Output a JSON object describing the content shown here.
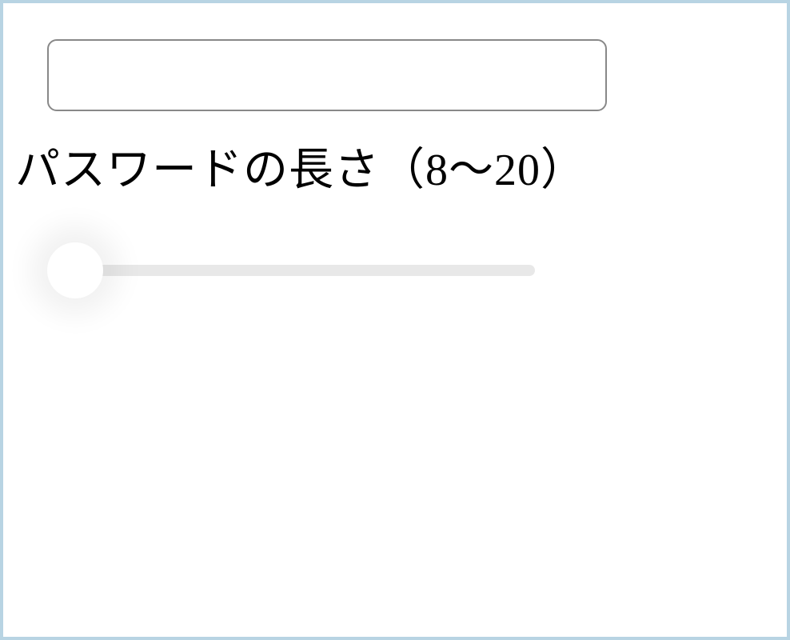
{
  "password": {
    "output_value": "",
    "length_label": "パスワードの長さ（8～20）",
    "slider_min": 8,
    "slider_max": 20,
    "slider_value": 8
  }
}
